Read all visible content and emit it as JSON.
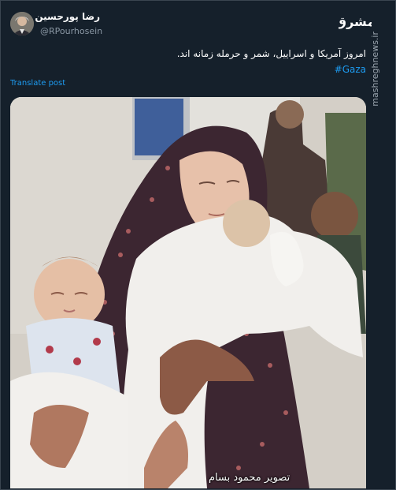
{
  "author": {
    "display_name": "رضا پورحسین",
    "handle": "@RPourhosein",
    "avatar_icon": "user-avatar"
  },
  "tweet": {
    "text": "امروز آمریکا و اسراییل، شمر و حرمله زمانه اند.",
    "hashtag": "#Gaza",
    "translate_label": "Translate post"
  },
  "watermark": {
    "logo_text": "مشرق",
    "side_text": "mashreghnews.ir"
  },
  "media": {
    "caption": "تصویر محمود بسام",
    "alt_icon": "photo-icon"
  },
  "colors": {
    "background": "#15202b",
    "link": "#1d9bf0",
    "secondary_text": "#8b98a5"
  }
}
